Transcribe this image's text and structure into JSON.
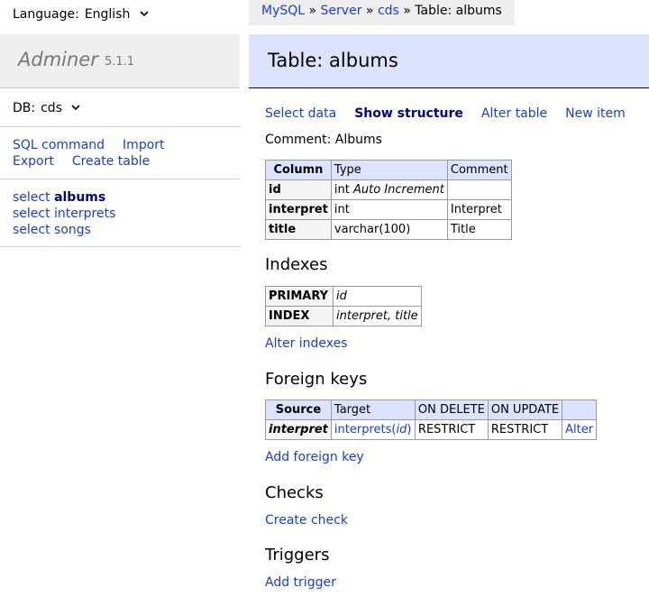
{
  "language": {
    "label": "Language:",
    "value": "English"
  },
  "logo": {
    "name": "Adminer",
    "version": "5.1.1"
  },
  "db": {
    "label": "DB:",
    "value": "cds"
  },
  "commands": {
    "sql": "SQL command",
    "import": "Import",
    "export": "Export",
    "create_table": "Create table"
  },
  "tables": {
    "t0": {
      "prefix": "select",
      "name": "albums"
    },
    "t1": "select interprets",
    "t2": "select songs"
  },
  "breadcrumb": {
    "mysql": "MySQL",
    "sep": " » ",
    "server": "Server",
    "db": "cds",
    "current": "Table: albums"
  },
  "page_title": "Table: albums",
  "links": {
    "select_data": "Select data",
    "show_structure": "Show structure",
    "alter_table": "Alter table",
    "new_item": "New item"
  },
  "comment": "Comment: Albums",
  "columns": {
    "headers": [
      "Column",
      "Type",
      "Comment"
    ],
    "rows": [
      {
        "name": "id",
        "type": "int",
        "extra": "Auto Increment",
        "comment": ""
      },
      {
        "name": "interpret",
        "type": "int",
        "extra": "",
        "comment": "Interpret"
      },
      {
        "name": "title",
        "type": "varchar(100)",
        "extra": "",
        "comment": "Title"
      }
    ]
  },
  "indexes": {
    "title": "Indexes",
    "rows": [
      {
        "type": "PRIMARY",
        "cols": "id"
      },
      {
        "type": "INDEX",
        "cols": "interpret, title"
      }
    ],
    "alter": "Alter indexes"
  },
  "foreign_keys": {
    "title": "Foreign keys",
    "headers": [
      "Source",
      "Target",
      "ON DELETE",
      "ON UPDATE",
      ""
    ],
    "row": {
      "source": "interpret",
      "target_table": "interprets",
      "target_col": "id",
      "on_delete": "RESTRICT",
      "on_update": "RESTRICT",
      "alter": "Alter"
    },
    "add": "Add foreign key"
  },
  "checks": {
    "title": "Checks",
    "create": "Create check"
  },
  "triggers": {
    "title": "Triggers",
    "add": "Add trigger"
  },
  "colors": {
    "link": "#1a3cd4",
    "header_bg": "#dde3ff",
    "menu_bg": "#eeeeee"
  }
}
